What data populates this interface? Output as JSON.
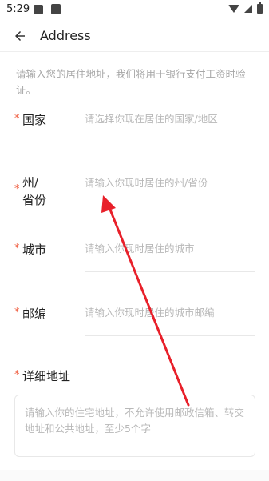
{
  "status_bar": {
    "time": "5:29"
  },
  "app_bar": {
    "back_icon": "arrow-left-icon",
    "title": "Address"
  },
  "intro": "请输入您的居住地址，我们将用于银行支付工资时验证。",
  "fields": [
    {
      "required": "*",
      "label": "国家",
      "placeholder": "请选择你现在居住的国家/地区"
    },
    {
      "required": "*",
      "label": "州/\n省份",
      "placeholder": "请输入你现时居住的州/省份"
    },
    {
      "required": "*",
      "label": "城市",
      "placeholder": "请输入你现时居住的城市"
    },
    {
      "required": "*",
      "label": "邮编",
      "placeholder": "请输入你现时居住的城市邮编"
    }
  ],
  "detail_address": {
    "required": "*",
    "label": "详细地址",
    "placeholder": "请输入你的住宅地址，不允许使用邮政信箱、转交地址和公共地址，至少5个字"
  },
  "annotation": {
    "color": "#e8202a"
  }
}
